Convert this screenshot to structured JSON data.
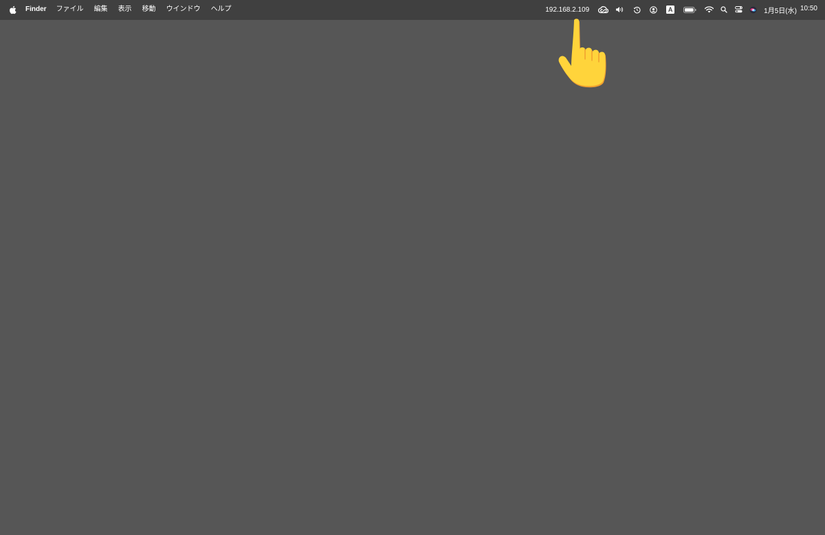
{
  "menubar": {
    "app_name": "Finder",
    "menus": [
      "ファイル",
      "編集",
      "表示",
      "移動",
      "ウインドウ",
      "ヘルプ"
    ],
    "status": {
      "ip_address": "192.168.2.109",
      "input_source": "A",
      "date": "1月5日(水)",
      "time": "10:50",
      "icons": [
        "creative-cloud-icon",
        "volume-icon",
        "time-machine-icon",
        "user-account-icon",
        "input-source-icon",
        "battery-icon",
        "wifi-icon",
        "spotlight-search-icon",
        "control-center-icon",
        "siri-icon"
      ]
    }
  },
  "overlay": {
    "pointer": "pointing-hand-icon"
  },
  "colors": {
    "menubar_bg": "#404040",
    "desktop_bg": "#565656",
    "text": "#ffffff",
    "hand_fill": "#ffd43b",
    "hand_outline": "#f0a030"
  }
}
